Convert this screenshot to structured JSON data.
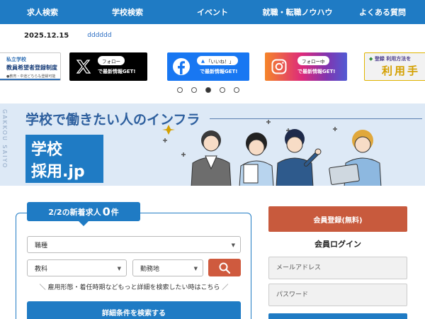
{
  "nav": {
    "items": [
      {
        "label": "求人検索"
      },
      {
        "label": "学校検索"
      },
      {
        "label": "イベント"
      },
      {
        "label": "就職・転職ノウハウ"
      },
      {
        "label": "よくある質問"
      }
    ]
  },
  "news": {
    "date": "2025.12.15",
    "text": "dddddd"
  },
  "banners": {
    "school": {
      "line1": "私立学校",
      "line2": "教員希望者登録制度",
      "line3": "●教育・中途どちらも登録可能"
    },
    "x": {
      "follow": "フォロー",
      "get": "で最新情報GET!"
    },
    "facebook": {
      "like": "「いいね！」",
      "get": "で最新情報GET!"
    },
    "instagram": {
      "follow": "フォロー中",
      "get": "で最新情報GET!"
    },
    "guide": {
      "top": "登録 利用方法を",
      "big": "利用手"
    }
  },
  "carousel": {
    "total": 5,
    "active": 2
  },
  "hero": {
    "tagline": "学校で働きたい人のインフラ",
    "vertical": "GAKKOU SAIYO",
    "logo_line1": "学校",
    "logo_line2": "採用.jp"
  },
  "search": {
    "new_prefix": "2/2の新着求人",
    "new_count": "0",
    "new_suffix": "件",
    "job_type": "職種",
    "subject": "教科",
    "location": "勤務地",
    "note": "＼ 雇用形態・着任時期などもっと詳細を検索したい時はこちら ／",
    "detail_button": "詳細条件を検索する"
  },
  "member": {
    "register": "会員登録(無料)",
    "login_title": "会員ログイン",
    "email_placeholder": "メールアドレス",
    "password_placeholder": "パスワード"
  },
  "colors": {
    "primary": "#1f7bc4",
    "accent": "#cf5a3e",
    "hero_bg": "#dde9f6"
  }
}
